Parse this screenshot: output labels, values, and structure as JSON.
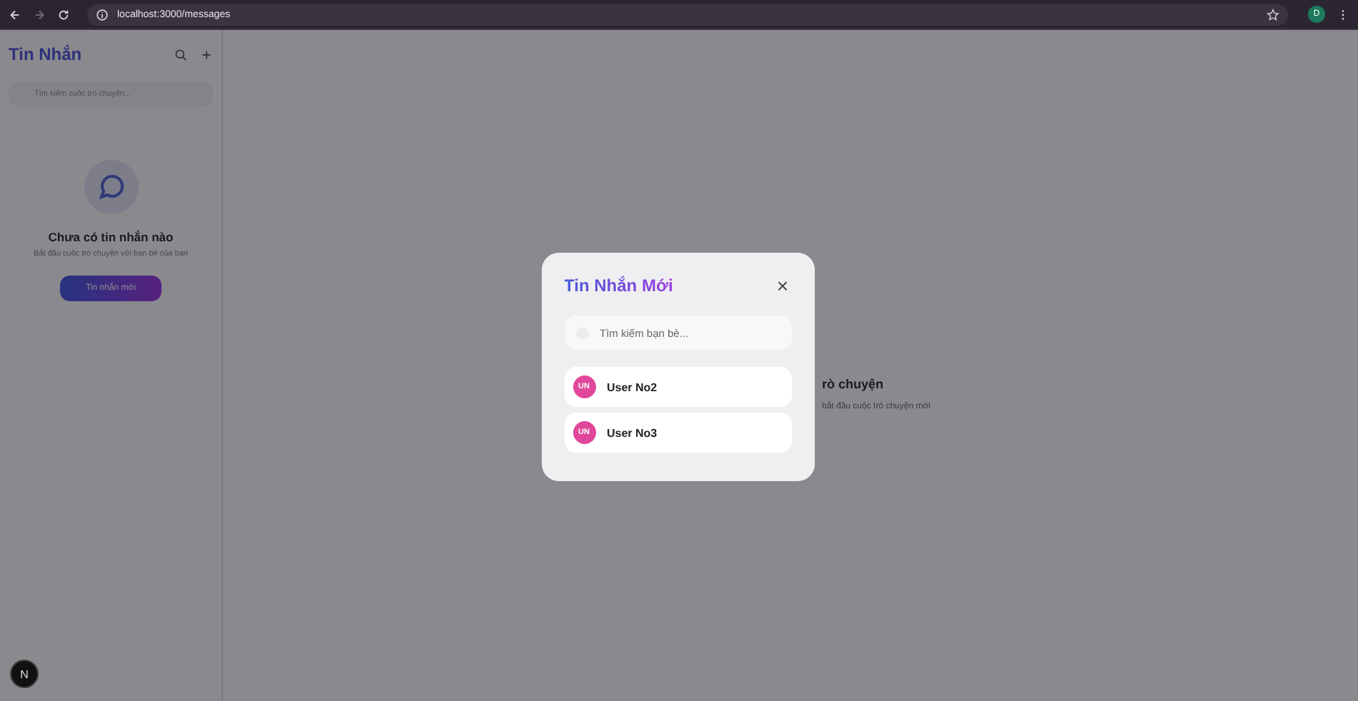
{
  "browser": {
    "url": "localhost:3000/messages",
    "profile_initial": "D"
  },
  "sidebar": {
    "title": "Tin Nhắn",
    "search_placeholder": "Tìm kiếm cuộc trò chuyện...",
    "empty_title": "Chưa có tin nhắn nào",
    "empty_text": "Bắt đầu cuộc trò chuyện với bạn bè của bạn",
    "new_button": "Tin nhắn mới"
  },
  "main": {
    "heading_visible": "rò chuyện",
    "text_visible": "bắt đầu cuộc trò chuyện mới"
  },
  "dev_badge": "N",
  "modal": {
    "title": "Tin Nhắn Mới",
    "close": "×",
    "search_placeholder": "Tìm kiếm bạn bè...",
    "users": [
      {
        "initials": "UN",
        "name": "User No2"
      },
      {
        "initials": "UN",
        "name": "User No3"
      }
    ]
  }
}
